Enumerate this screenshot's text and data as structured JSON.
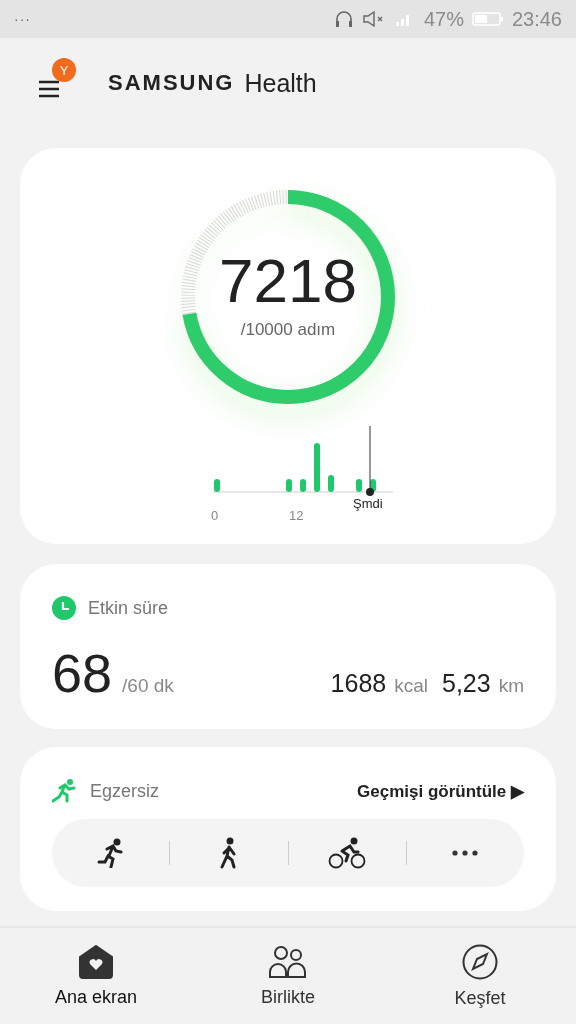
{
  "status_bar": {
    "menu": "···",
    "battery_text": "47%",
    "time": "23:46"
  },
  "header": {
    "badge": "Y",
    "brand": "SAMSUNG",
    "app": "Health"
  },
  "steps": {
    "count": "7218",
    "goal": "/10000 adım",
    "level": 0.7218,
    "axis_labels": [
      "0",
      "12"
    ],
    "now_label": "Şmdi"
  },
  "active_time": {
    "title": "Etkin süre",
    "value": "68",
    "goal": "/60 dk",
    "calories": "1688",
    "calories_unit": "kcal",
    "distance": "5,23",
    "distance_unit": "km"
  },
  "exercise": {
    "title": "Egzersiz",
    "history_link": "Geçmişi görüntüle ▶",
    "activities": [
      {
        "kind": "run"
      },
      {
        "kind": "walk"
      },
      {
        "kind": "bike"
      },
      {
        "kind": "more"
      }
    ]
  },
  "nav": [
    {
      "label": "Ana ekran",
      "kind": "home",
      "selected": true
    },
    {
      "label": "Birlikte",
      "kind": "together",
      "selected": false
    },
    {
      "label": "Keşfet",
      "kind": "discover",
      "selected": false
    }
  ]
}
